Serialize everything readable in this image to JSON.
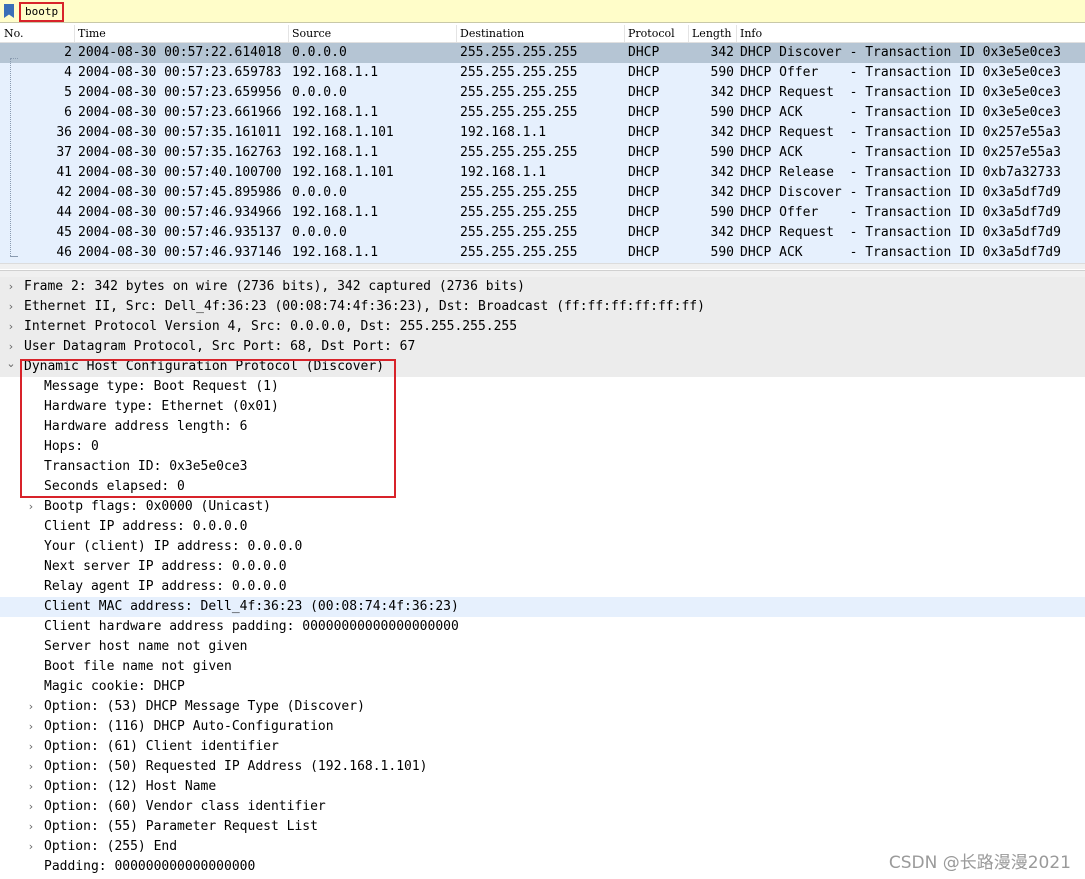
{
  "filter": {
    "value": "bootp"
  },
  "packet_list": {
    "columns": {
      "no": "No.",
      "time": "Time",
      "source": "Source",
      "destination": "Destination",
      "protocol": "Protocol",
      "length": "Length",
      "info": "Info"
    },
    "rows": [
      {
        "no": "2",
        "time": "2004-08-30 00:57:22.614018",
        "source": "0.0.0.0",
        "destination": "255.255.255.255",
        "protocol": "DHCP",
        "length": "342",
        "info": "DHCP Discover - Transaction ID 0x3e5e0ce3"
      },
      {
        "no": "4",
        "time": "2004-08-30 00:57:23.659783",
        "source": "192.168.1.1",
        "destination": "255.255.255.255",
        "protocol": "DHCP",
        "length": "590",
        "info": "DHCP Offer    - Transaction ID 0x3e5e0ce3"
      },
      {
        "no": "5",
        "time": "2004-08-30 00:57:23.659956",
        "source": "0.0.0.0",
        "destination": "255.255.255.255",
        "protocol": "DHCP",
        "length": "342",
        "info": "DHCP Request  - Transaction ID 0x3e5e0ce3"
      },
      {
        "no": "6",
        "time": "2004-08-30 00:57:23.661966",
        "source": "192.168.1.1",
        "destination": "255.255.255.255",
        "protocol": "DHCP",
        "length": "590",
        "info": "DHCP ACK      - Transaction ID 0x3e5e0ce3"
      },
      {
        "no": "36",
        "time": "2004-08-30 00:57:35.161011",
        "source": "192.168.1.101",
        "destination": "192.168.1.1",
        "protocol": "DHCP",
        "length": "342",
        "info": "DHCP Request  - Transaction ID 0x257e55a3"
      },
      {
        "no": "37",
        "time": "2004-08-30 00:57:35.162763",
        "source": "192.168.1.1",
        "destination": "255.255.255.255",
        "protocol": "DHCP",
        "length": "590",
        "info": "DHCP ACK      - Transaction ID 0x257e55a3"
      },
      {
        "no": "41",
        "time": "2004-08-30 00:57:40.100700",
        "source": "192.168.1.101",
        "destination": "192.168.1.1",
        "protocol": "DHCP",
        "length": "342",
        "info": "DHCP Release  - Transaction ID 0xb7a32733"
      },
      {
        "no": "42",
        "time": "2004-08-30 00:57:45.895986",
        "source": "0.0.0.0",
        "destination": "255.255.255.255",
        "protocol": "DHCP",
        "length": "342",
        "info": "DHCP Discover - Transaction ID 0x3a5df7d9"
      },
      {
        "no": "44",
        "time": "2004-08-30 00:57:46.934966",
        "source": "192.168.1.1",
        "destination": "255.255.255.255",
        "protocol": "DHCP",
        "length": "590",
        "info": "DHCP Offer    - Transaction ID 0x3a5df7d9"
      },
      {
        "no": "45",
        "time": "2004-08-30 00:57:46.935137",
        "source": "0.0.0.0",
        "destination": "255.255.255.255",
        "protocol": "DHCP",
        "length": "342",
        "info": "DHCP Request  - Transaction ID 0x3a5df7d9"
      },
      {
        "no": "46",
        "time": "2004-08-30 00:57:46.937146",
        "source": "192.168.1.1",
        "destination": "255.255.255.255",
        "protocol": "DHCP",
        "length": "590",
        "info": "DHCP ACK      - Transaction ID 0x3a5df7d9"
      }
    ]
  },
  "details": {
    "lines": [
      {
        "text": "Frame 2: 342 bytes on wire (2736 bits), 342 captured (2736 bits)",
        "arrow": "collapsed",
        "indent": 0,
        "shade": true
      },
      {
        "text": "Ethernet II, Src: Dell_4f:36:23 (00:08:74:4f:36:23), Dst: Broadcast (ff:ff:ff:ff:ff:ff)",
        "arrow": "collapsed",
        "indent": 0,
        "shade": true
      },
      {
        "text": "Internet Protocol Version 4, Src: 0.0.0.0, Dst: 255.255.255.255",
        "arrow": "collapsed",
        "indent": 0,
        "shade": true
      },
      {
        "text": "User Datagram Protocol, Src Port: 68, Dst Port: 67",
        "arrow": "collapsed",
        "indent": 0,
        "shade": true
      },
      {
        "text": "Dynamic Host Configuration Protocol (Discover)",
        "arrow": "expanded",
        "indent": 0,
        "shade": true
      },
      {
        "text": "Message type: Boot Request (1)",
        "arrow": "",
        "indent": 1
      },
      {
        "text": "Hardware type: Ethernet (0x01)",
        "arrow": "",
        "indent": 1
      },
      {
        "text": "Hardware address length: 6",
        "arrow": "",
        "indent": 1
      },
      {
        "text": "Hops: 0",
        "arrow": "",
        "indent": 1
      },
      {
        "text": "Transaction ID: 0x3e5e0ce3",
        "arrow": "",
        "indent": 1
      },
      {
        "text": "Seconds elapsed: 0",
        "arrow": "",
        "indent": 1
      },
      {
        "text": "Bootp flags: 0x0000 (Unicast)",
        "arrow": "collapsed",
        "indent": 1
      },
      {
        "text": "Client IP address: 0.0.0.0",
        "arrow": "",
        "indent": 1
      },
      {
        "text": "Your (client) IP address: 0.0.0.0",
        "arrow": "",
        "indent": 1
      },
      {
        "text": "Next server IP address: 0.0.0.0",
        "arrow": "",
        "indent": 1
      },
      {
        "text": "Relay agent IP address: 0.0.0.0",
        "arrow": "",
        "indent": 1
      },
      {
        "text": "Client MAC address: Dell_4f:36:23 (00:08:74:4f:36:23)",
        "arrow": "",
        "indent": 1,
        "highlight": true
      },
      {
        "text": "Client hardware address padding: 00000000000000000000",
        "arrow": "",
        "indent": 1
      },
      {
        "text": "Server host name not given",
        "arrow": "",
        "indent": 1
      },
      {
        "text": "Boot file name not given",
        "arrow": "",
        "indent": 1
      },
      {
        "text": "Magic cookie: DHCP",
        "arrow": "",
        "indent": 1
      },
      {
        "text": "Option: (53) DHCP Message Type (Discover)",
        "arrow": "collapsed",
        "indent": 1
      },
      {
        "text": "Option: (116) DHCP Auto-Configuration",
        "arrow": "collapsed",
        "indent": 1
      },
      {
        "text": "Option: (61) Client identifier",
        "arrow": "collapsed",
        "indent": 1
      },
      {
        "text": "Option: (50) Requested IP Address (192.168.1.101)",
        "arrow": "collapsed",
        "indent": 1
      },
      {
        "text": "Option: (12) Host Name",
        "arrow": "collapsed",
        "indent": 1
      },
      {
        "text": "Option: (60) Vendor class identifier",
        "arrow": "collapsed",
        "indent": 1
      },
      {
        "text": "Option: (55) Parameter Request List",
        "arrow": "collapsed",
        "indent": 1
      },
      {
        "text": "Option: (255) End",
        "arrow": "collapsed",
        "indent": 1
      },
      {
        "text": "Padding: 000000000000000000",
        "arrow": "",
        "indent": 1
      }
    ]
  },
  "watermark": "CSDN @长路漫漫2021",
  "colors": {
    "filter_bg": "#fffdc9",
    "row_bg": "#e6f0fd",
    "selected_row_bg": "#b5c5d4",
    "highlight_box": "#d8232a"
  }
}
